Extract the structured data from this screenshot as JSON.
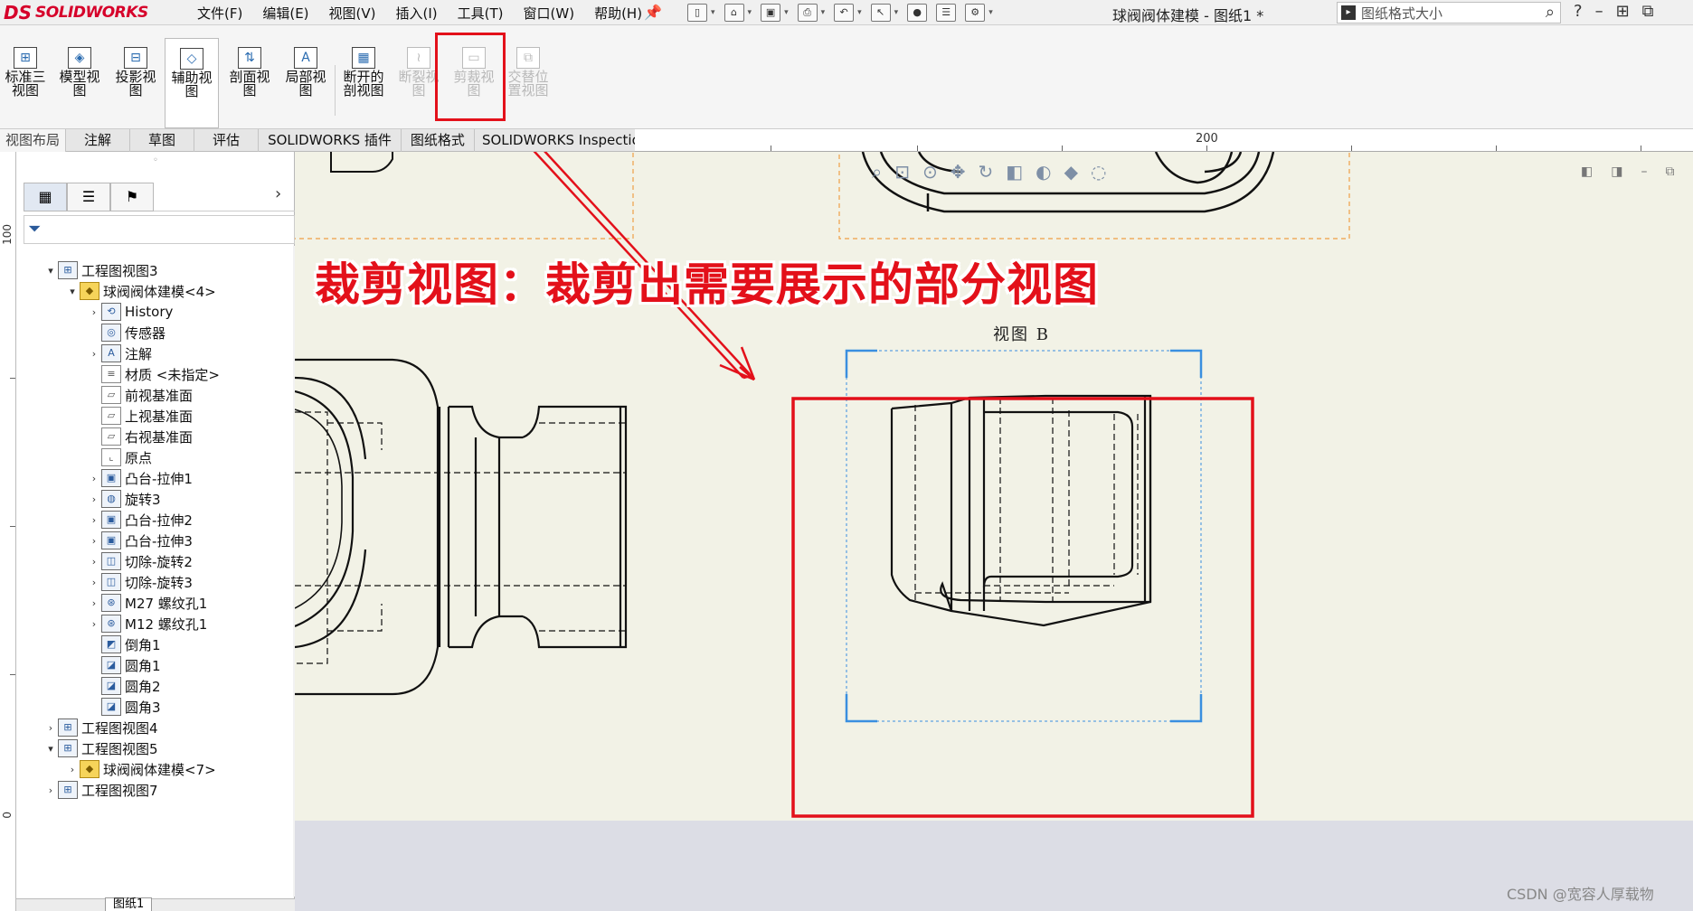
{
  "app": {
    "logo_ds": "DS",
    "logo_name": "SOLIDWORKS",
    "document_title": "球阀阀体建模 - 图纸1 *",
    "search_placeholder": "图纸格式大小"
  },
  "menu": [
    "文件(F)",
    "编辑(E)",
    "视图(V)",
    "插入(I)",
    "工具(T)",
    "窗口(W)",
    "帮助(H)"
  ],
  "quick_access_icons": [
    "new-icon",
    "open-icon",
    "save-icon",
    "print-icon",
    "undo-icon",
    "select-icon",
    "traffic-light-icon",
    "options-list-icon",
    "settings-icon"
  ],
  "toolbar": {
    "tools": [
      {
        "label1": "标准三",
        "label2": "视图",
        "icon": "standard-3-view-icon",
        "state": "normal"
      },
      {
        "label1": "模型视",
        "label2": "图",
        "icon": "model-view-icon",
        "state": "normal"
      },
      {
        "label1": "投影视",
        "label2": "图",
        "icon": "projected-view-icon",
        "state": "normal"
      },
      {
        "label1": "辅助视",
        "label2": "图",
        "icon": "auxiliary-view-icon",
        "state": "active"
      },
      {
        "label1": "剖面视",
        "label2": "图",
        "icon": "section-view-icon",
        "state": "normal"
      },
      {
        "label1": "局部视",
        "label2": "图",
        "icon": "detail-view-icon",
        "state": "normal"
      },
      {
        "label1": "断开的",
        "label2": "剖视图",
        "icon": "broken-out-section-icon",
        "state": "normal"
      },
      {
        "label1": "断裂视",
        "label2": "图",
        "icon": "break-view-icon",
        "state": "disabled"
      },
      {
        "label1": "剪裁视",
        "label2": "图",
        "icon": "crop-view-icon",
        "state": "disabled"
      },
      {
        "label1": "交替位",
        "label2": "置视图",
        "icon": "alternate-position-view-icon",
        "state": "disabled"
      }
    ]
  },
  "tabs": [
    "视图布局",
    "注解",
    "草图",
    "评估",
    "SOLIDWORKS 插件",
    "图纸格式",
    "SOLIDWORKS Inspection"
  ],
  "ruler": {
    "top_label": "200",
    "left_labels": [
      "100",
      "0"
    ]
  },
  "feature_tree": [
    {
      "label": "工程图视图3",
      "level": 0,
      "expander": "open",
      "icon": "drawing-view-icon"
    },
    {
      "label": "球阀阀体建模<4>",
      "level": 1,
      "expander": "open",
      "icon": "part-icon"
    },
    {
      "label": "History",
      "level": 2,
      "expander": "closed",
      "icon": "history-icon"
    },
    {
      "label": "传感器",
      "level": 2,
      "expander": "none",
      "icon": "sensor-icon"
    },
    {
      "label": "注解",
      "level": 2,
      "expander": "closed",
      "icon": "annotation-icon"
    },
    {
      "label": "材质 <未指定>",
      "level": 2,
      "expander": "none",
      "icon": "material-icon"
    },
    {
      "label": "前视基准面",
      "level": 2,
      "expander": "none",
      "icon": "plane-icon"
    },
    {
      "label": "上视基准面",
      "level": 2,
      "expander": "none",
      "icon": "plane-icon"
    },
    {
      "label": "右视基准面",
      "level": 2,
      "expander": "none",
      "icon": "plane-icon"
    },
    {
      "label": "原点",
      "level": 2,
      "expander": "none",
      "icon": "origin-icon"
    },
    {
      "label": "凸台-拉伸1",
      "level": 2,
      "expander": "closed",
      "icon": "boss-extrude-icon"
    },
    {
      "label": "旋转3",
      "level": 2,
      "expander": "closed",
      "icon": "revolve-icon"
    },
    {
      "label": "凸台-拉伸2",
      "level": 2,
      "expander": "closed",
      "icon": "boss-extrude-icon"
    },
    {
      "label": "凸台-拉伸3",
      "level": 2,
      "expander": "closed",
      "icon": "boss-extrude-icon"
    },
    {
      "label": "切除-旋转2",
      "level": 2,
      "expander": "closed",
      "icon": "cut-revolve-icon"
    },
    {
      "label": "切除-旋转3",
      "level": 2,
      "expander": "closed",
      "icon": "cut-revolve-icon"
    },
    {
      "label": "M27 螺纹孔1",
      "level": 2,
      "expander": "closed",
      "icon": "hole-wizard-icon"
    },
    {
      "label": "M12 螺纹孔1",
      "level": 2,
      "expander": "closed",
      "icon": "hole-wizard-icon"
    },
    {
      "label": "倒角1",
      "level": 2,
      "expander": "none",
      "icon": "chamfer-icon"
    },
    {
      "label": "圆角1",
      "level": 2,
      "expander": "none",
      "icon": "fillet-icon"
    },
    {
      "label": "圆角2",
      "level": 2,
      "expander": "none",
      "icon": "fillet-icon"
    },
    {
      "label": "圆角3",
      "level": 2,
      "expander": "none",
      "icon": "fillet-icon"
    },
    {
      "label": "工程图视图4",
      "level": 0,
      "expander": "closed",
      "icon": "drawing-view-icon"
    },
    {
      "label": "工程图视图5",
      "level": 0,
      "expander": "open",
      "icon": "drawing-view-icon"
    },
    {
      "label": "球阀阀体建模<7>",
      "level": 1,
      "expander": "closed",
      "icon": "part-icon"
    },
    {
      "label": "工程图视图7",
      "level": 0,
      "expander": "closed",
      "icon": "drawing-view-icon"
    }
  ],
  "sheet_tab": "图纸1",
  "drawing": {
    "view_label": "视图 B",
    "annotation": "裁剪视图：裁剪出需要展示的部分视图",
    "highlight_color": "#e3101a",
    "crop_frame_color": "#3a8fe0"
  },
  "watermark": "CSDN @宽容人厚载物"
}
